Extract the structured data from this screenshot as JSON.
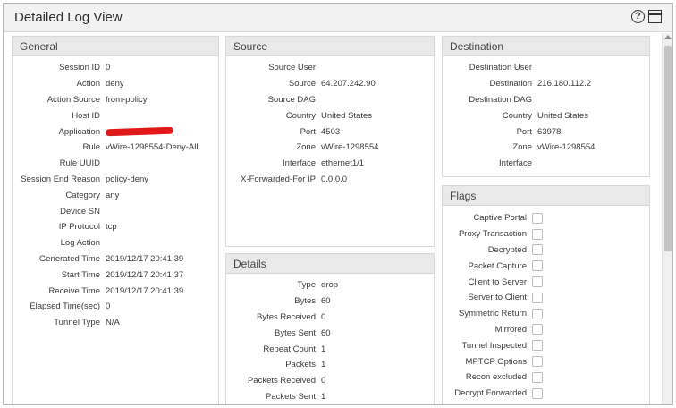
{
  "window": {
    "title": "Detailed Log View"
  },
  "general": {
    "header": "General",
    "rows": [
      {
        "label": "Session ID",
        "value": "0"
      },
      {
        "label": "Action",
        "value": "deny"
      },
      {
        "label": "Action Source",
        "value": "from-policy"
      },
      {
        "label": "Host ID",
        "value": ""
      },
      {
        "label": "Application",
        "value": "",
        "redacted": true
      },
      {
        "label": "Rule",
        "value": "vWire-1298554-Deny-All"
      },
      {
        "label": "Rule UUID",
        "value": ""
      },
      {
        "label": "Session End Reason",
        "value": "policy-deny"
      },
      {
        "label": "Category",
        "value": "any"
      },
      {
        "label": "Device SN",
        "value": ""
      },
      {
        "label": "IP Protocol",
        "value": "tcp"
      },
      {
        "label": "Log Action",
        "value": ""
      },
      {
        "label": "Generated Time",
        "value": "2019/12/17 20:41:39"
      },
      {
        "label": "Start Time",
        "value": "2019/12/17 20:41:37"
      },
      {
        "label": "Receive Time",
        "value": "2019/12/17 20:41:39"
      },
      {
        "label": "Elapsed Time(sec)",
        "value": "0"
      },
      {
        "label": "Tunnel Type",
        "value": "N/A"
      }
    ]
  },
  "source": {
    "header": "Source",
    "rows": [
      {
        "label": "Source User",
        "value": ""
      },
      {
        "label": "Source",
        "value": "64.207.242.90"
      },
      {
        "label": "Source DAG",
        "value": ""
      },
      {
        "label": "Country",
        "value": "United States"
      },
      {
        "label": "Port",
        "value": "4503"
      },
      {
        "label": "Zone",
        "value": "vWire-1298554"
      },
      {
        "label": "Interface",
        "value": "ethernet1/1"
      },
      {
        "label": "X-Forwarded-For IP",
        "value": "0.0.0.0"
      }
    ]
  },
  "destination": {
    "header": "Destination",
    "rows": [
      {
        "label": "Destination User",
        "value": ""
      },
      {
        "label": "Destination",
        "value": "216.180.112.2"
      },
      {
        "label": "Destination DAG",
        "value": ""
      },
      {
        "label": "Country",
        "value": "United States"
      },
      {
        "label": "Port",
        "value": "63978"
      },
      {
        "label": "Zone",
        "value": "vWire-1298554"
      },
      {
        "label": "Interface",
        "value": ""
      }
    ]
  },
  "details": {
    "header": "Details",
    "rows": [
      {
        "label": "Type",
        "value": "drop"
      },
      {
        "label": "Bytes",
        "value": "60"
      },
      {
        "label": "Bytes Received",
        "value": "0"
      },
      {
        "label": "Bytes Sent",
        "value": "60"
      },
      {
        "label": "Repeat Count",
        "value": "1"
      },
      {
        "label": "Packets",
        "value": "1"
      },
      {
        "label": "Packets Received",
        "value": "0"
      },
      {
        "label": "Packets Sent",
        "value": "1"
      }
    ]
  },
  "flags": {
    "header": "Flags",
    "rows": [
      {
        "label": "Captive Portal",
        "checked": false
      },
      {
        "label": "Proxy Transaction",
        "checked": false
      },
      {
        "label": "Decrypted",
        "checked": false
      },
      {
        "label": "Packet Capture",
        "checked": false
      },
      {
        "label": "Client to Server",
        "checked": false
      },
      {
        "label": "Server to Client",
        "checked": false
      },
      {
        "label": "Symmetric Return",
        "checked": false
      },
      {
        "label": "Mirrored",
        "checked": false
      },
      {
        "label": "Tunnel Inspected",
        "checked": false
      },
      {
        "label": "MPTCP Options",
        "checked": false
      },
      {
        "label": "Recon excluded",
        "checked": false
      },
      {
        "label": "Decrypt Forwarded",
        "checked": false
      }
    ]
  }
}
